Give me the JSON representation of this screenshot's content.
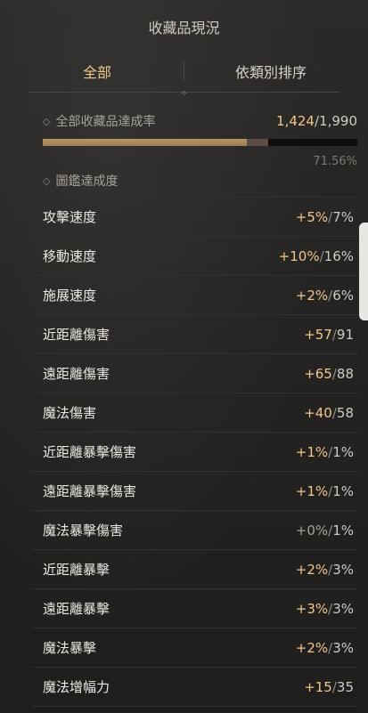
{
  "header": {
    "title": "收藏品現況"
  },
  "tabs": [
    {
      "label": "全部",
      "active": true
    },
    {
      "label": "依類別排序",
      "active": false
    }
  ],
  "collection": {
    "label": "全部收藏品達成率",
    "current": "1,424",
    "total": "1,990",
    "percent_text": "71.56%",
    "fraction": 0.7156
  },
  "codex": {
    "label": "圖鑑達成度"
  },
  "rows": [
    {
      "name": "攻擊速度",
      "current": "+5%",
      "max": "7%"
    },
    {
      "name": "移動速度",
      "current": "+10%",
      "max": "16%"
    },
    {
      "name": "施展速度",
      "current": "+2%",
      "max": "6%"
    },
    {
      "name": "近距離傷害",
      "current": "+57",
      "max": "91"
    },
    {
      "name": "遠距離傷害",
      "current": "+65",
      "max": "88"
    },
    {
      "name": "魔法傷害",
      "current": "+40",
      "max": "58"
    },
    {
      "name": "近距離暴擊傷害",
      "current": "+1%",
      "max": "1%"
    },
    {
      "name": "遠距離暴擊傷害",
      "current": "+1%",
      "max": "1%"
    },
    {
      "name": "魔法暴擊傷害",
      "current": "+0%",
      "max": "1%",
      "zero": true
    },
    {
      "name": "近距離暴擊",
      "current": "+2%",
      "max": "3%"
    },
    {
      "name": "遠距離暴擊",
      "current": "+3%",
      "max": "3%"
    },
    {
      "name": "魔法暴擊",
      "current": "+2%",
      "max": "3%"
    },
    {
      "name": "魔法增幅力",
      "current": "+15",
      "max": "35"
    }
  ],
  "colors": {
    "accent": "#f0c68a",
    "background": "#252422"
  }
}
